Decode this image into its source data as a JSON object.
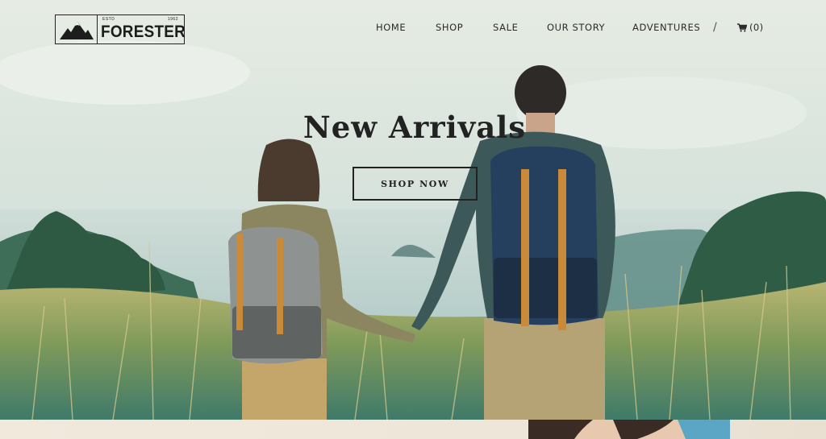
{
  "brand": {
    "name": "FORESTER",
    "estd_label": "ESTD",
    "year_label": "1962"
  },
  "nav": {
    "items": [
      {
        "label": "HOME"
      },
      {
        "label": "SHOP"
      },
      {
        "label": "SALE"
      },
      {
        "label": "OUR STORY"
      },
      {
        "label": "ADVENTURES"
      }
    ],
    "separator": "/",
    "cart": {
      "icon": "shopping-cart-icon",
      "count_label": "(0)"
    }
  },
  "hero": {
    "title": "New Arrivals",
    "cta_label": "SHOP NOW"
  }
}
